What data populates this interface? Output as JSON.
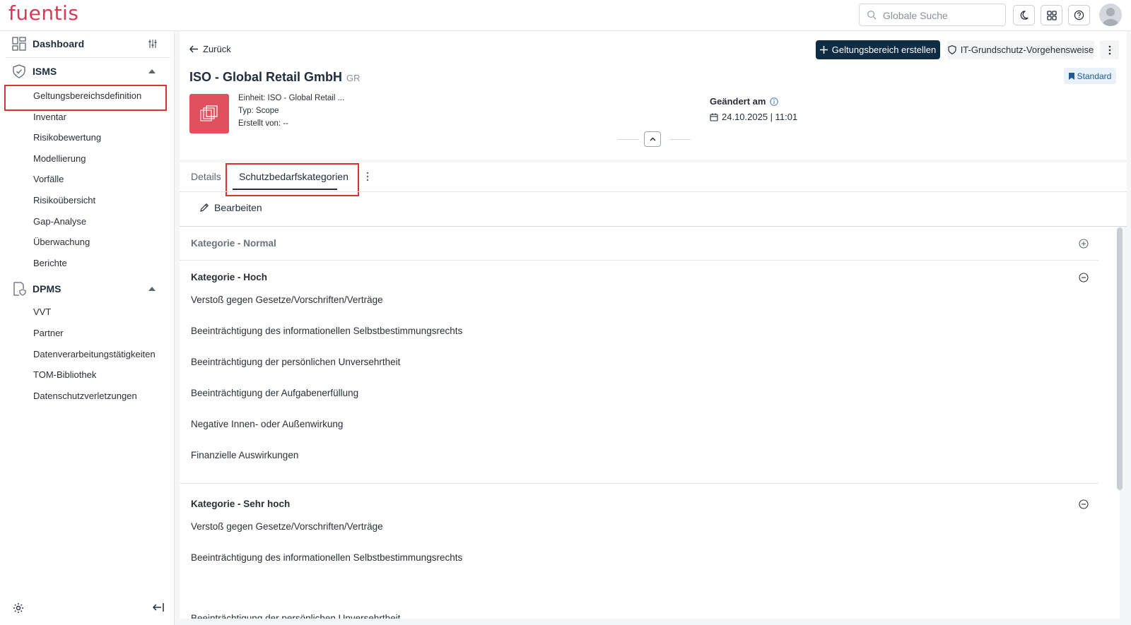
{
  "app": {
    "logo": "fuentis"
  },
  "topbar": {
    "search_placeholder": "Globale Suche",
    "icons": [
      "moon-icon",
      "grid-icon",
      "help-icon",
      "user-avatar"
    ]
  },
  "sidebar": {
    "dashboard": "Dashboard",
    "isms": {
      "label": "ISMS",
      "items": [
        "Geltungsbereichsdefinition",
        "Inventar",
        "Risikobewertung",
        "Modellierung",
        "Vorfälle",
        "Risikoübersicht",
        "Gap-Analyse",
        "Überwachung",
        "Berichte"
      ]
    },
    "dpms": {
      "label": "DPMS",
      "items": [
        "VVT",
        "Partner",
        "Datenverarbeitungstätigkeiten",
        "TOM-Bibliothek",
        "Datenschutzverletzungen"
      ]
    }
  },
  "header": {
    "back": "Zurück",
    "create_button": "Geltungsbereich erstellen",
    "approach_button": "IT-Grundschutz-Vorgehensweise",
    "title": "ISO - Global Retail GmbH",
    "title_suffix": "GR",
    "badge": "Standard",
    "meta": {
      "einheit": "Einheit: ISO - Global Retail ...",
      "typ": "Typ: Scope",
      "erstellt": "Erstellt von: --"
    },
    "changed_label": "Geändert am",
    "changed_value": "24.10.2025 | 11:01"
  },
  "tabs": {
    "details": "Details",
    "active": "Schutzbedarfskategorien",
    "edit": "Bearbeiten"
  },
  "categories": [
    {
      "title": "Kategorie - Normal",
      "expanded": false,
      "items": []
    },
    {
      "title": "Kategorie - Hoch",
      "expanded": true,
      "items": [
        "Verstoß gegen Gesetze/Vorschriften/Verträge",
        "Beeinträchtigung des informationellen Selbstbestimmungsrechts",
        "Beeinträchtigung der persönlichen Unversehrtheit",
        "Beeinträchtigung der Aufgabenerfüllung",
        "Negative Innen- oder Außenwirkung",
        "Finanzielle Auswirkungen"
      ]
    },
    {
      "title": "Kategorie - Sehr hoch",
      "expanded": true,
      "items": [
        "Verstoß gegen Gesetze/Vorschriften/Verträge",
        "Beeinträchtigung des informationellen Selbstbestimmungsrechts",
        "Beeinträchtigung der persönlichen Unversehrtheit"
      ]
    }
  ],
  "colors": {
    "brand": "#d63a55",
    "primary": "#0e2d45",
    "highlight": "#d9342b"
  }
}
